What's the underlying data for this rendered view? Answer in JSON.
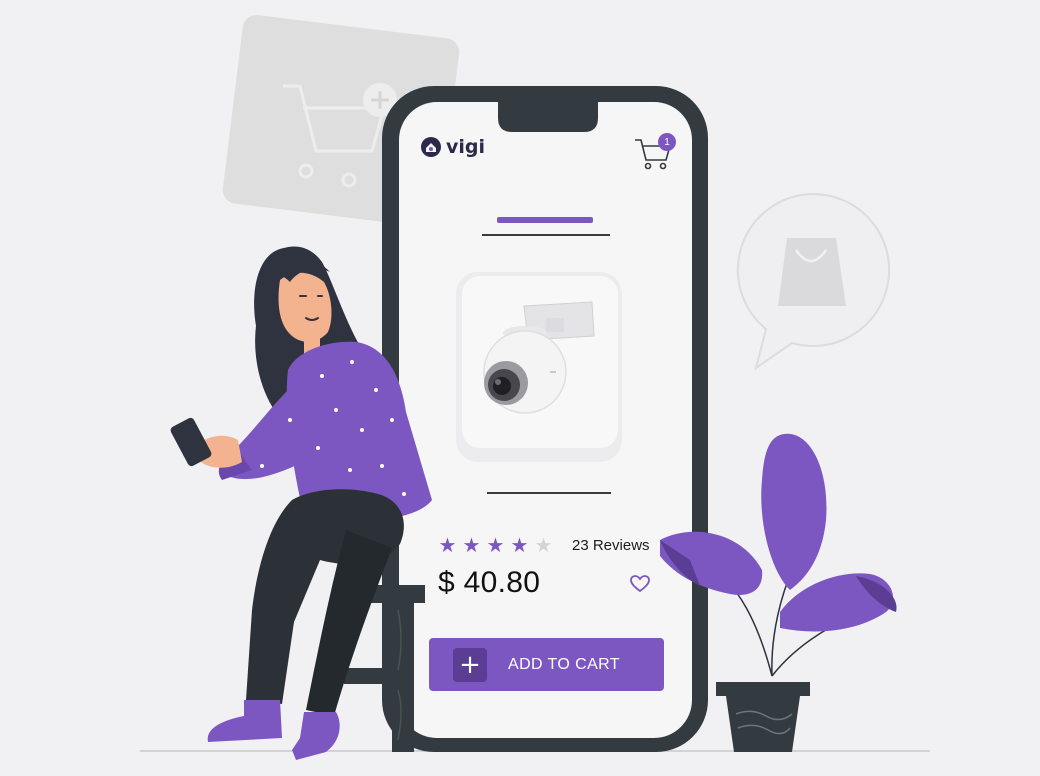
{
  "brand": {
    "name": "vigi",
    "logo_icon": "vigi-logo-icon"
  },
  "cart": {
    "icon": "cart-icon",
    "badge_count": "1"
  },
  "product": {
    "image_icon": "security-camera-icon",
    "rating": 4,
    "rating_max": 5,
    "reviews_text": "23 Reviews",
    "price": "$ 40.80"
  },
  "actions": {
    "wishlist_icon": "heart-icon",
    "add_to_cart_label": "ADD TO CART",
    "add_icon": "plus-icon"
  },
  "colors": {
    "accent": "#7d57c1",
    "accent_dark": "#5b3d93",
    "phone_frame": "#333a3f",
    "background": "#f1f1f3"
  }
}
